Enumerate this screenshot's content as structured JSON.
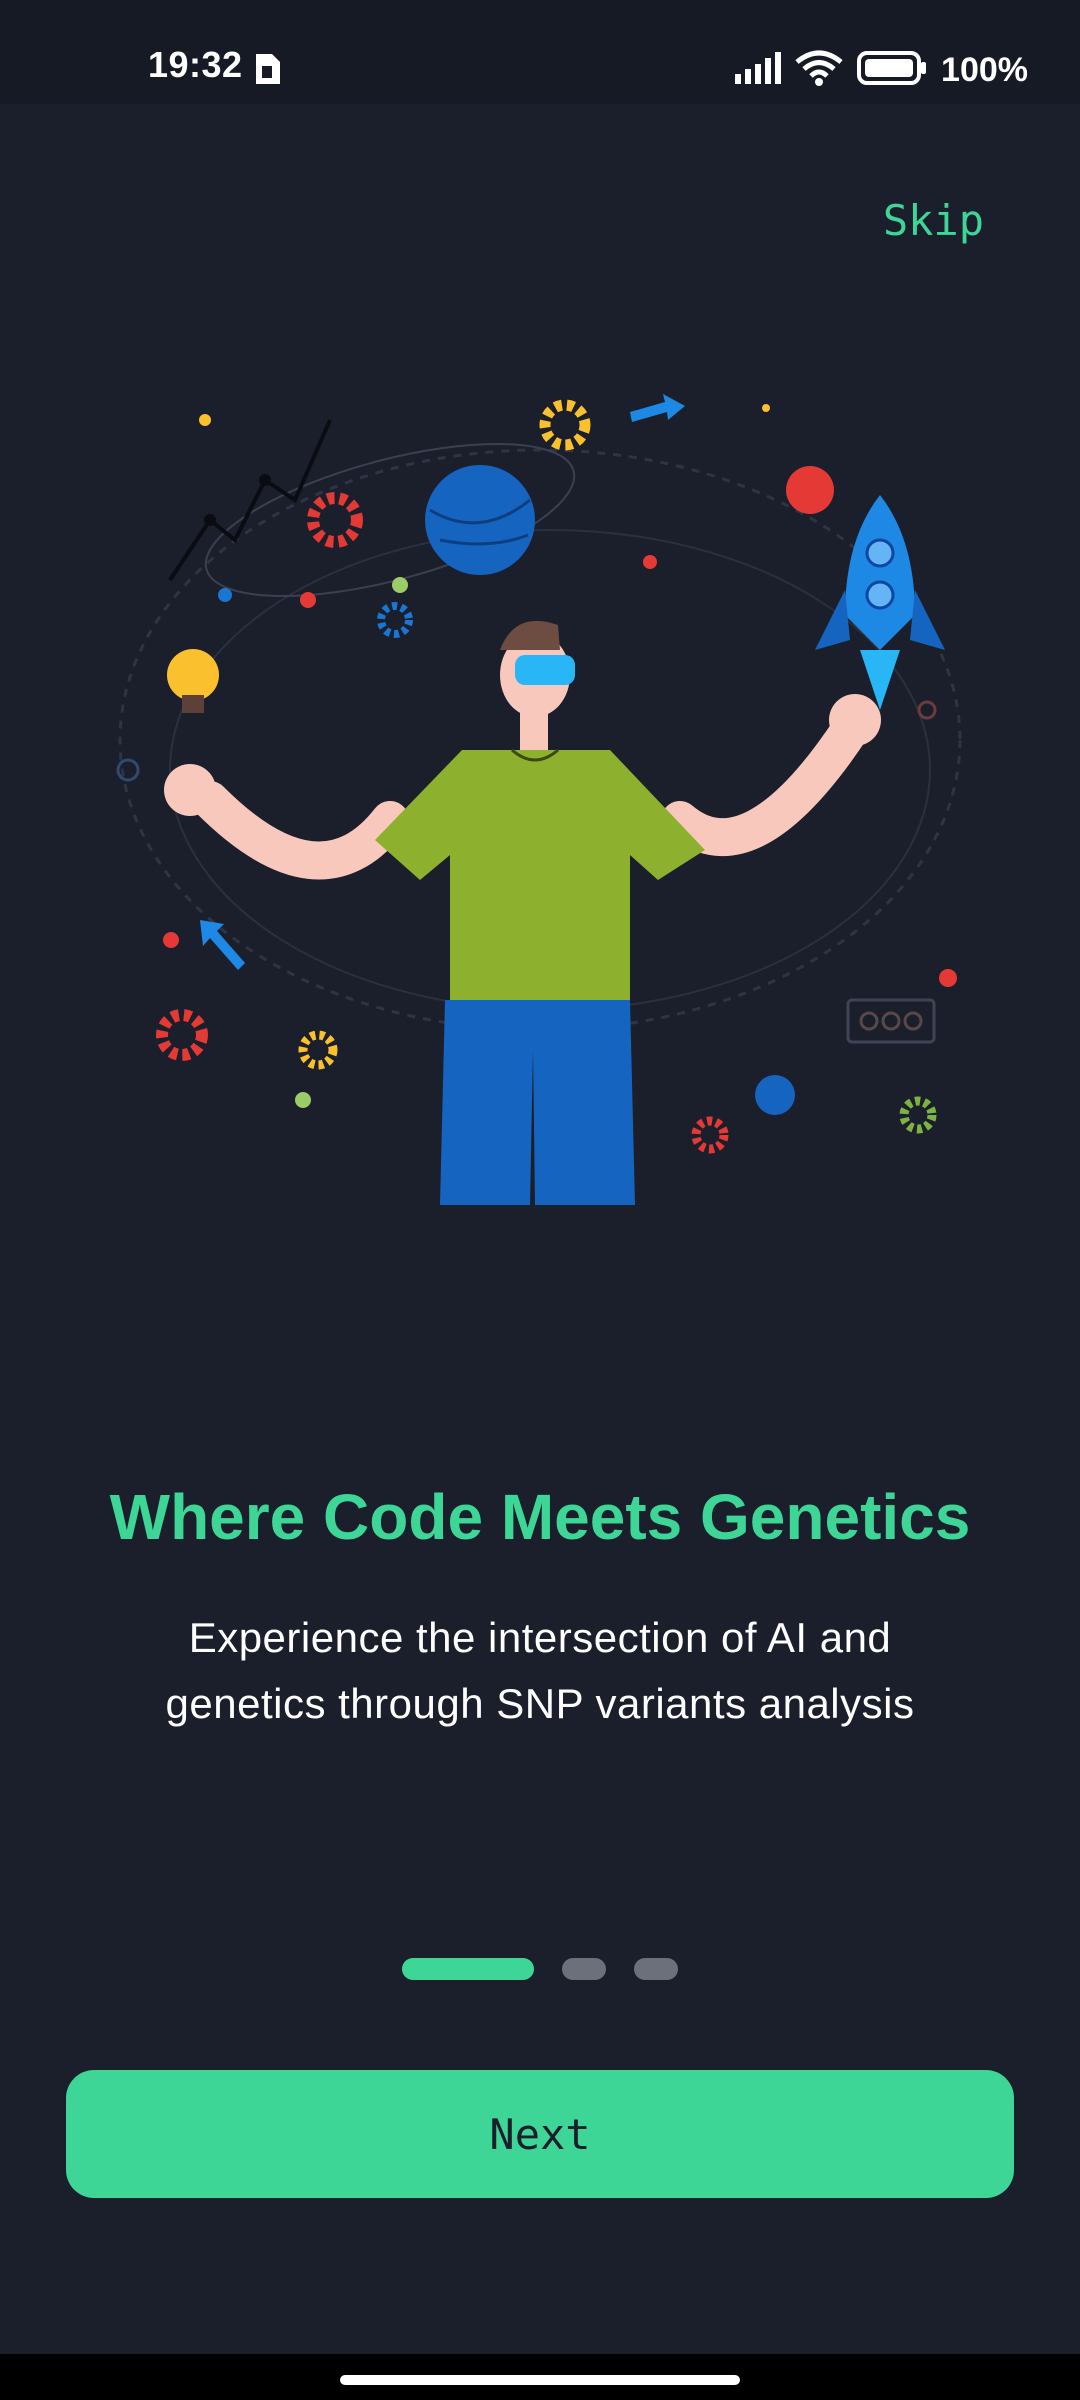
{
  "status_bar": {
    "time": "19:32",
    "battery_text": "100%",
    "icons": [
      "sim-card-icon",
      "signal-icon",
      "wifi-icon",
      "battery-icon"
    ]
  },
  "header": {
    "skip_label": "Skip"
  },
  "onboarding": {
    "title": "Where Code Meets Genetics",
    "subtitle_line1": "Experience the intersection of AI and",
    "subtitle_line2": "genetics through SNP variants analysis",
    "page_indicator": {
      "total": 3,
      "active": 1
    }
  },
  "footer": {
    "next_label": "Next"
  },
  "colors": {
    "background": "#1b1f2b",
    "accent": "#3dd697",
    "indicator_inactive": "#6c707b",
    "text": "#ffffff"
  }
}
